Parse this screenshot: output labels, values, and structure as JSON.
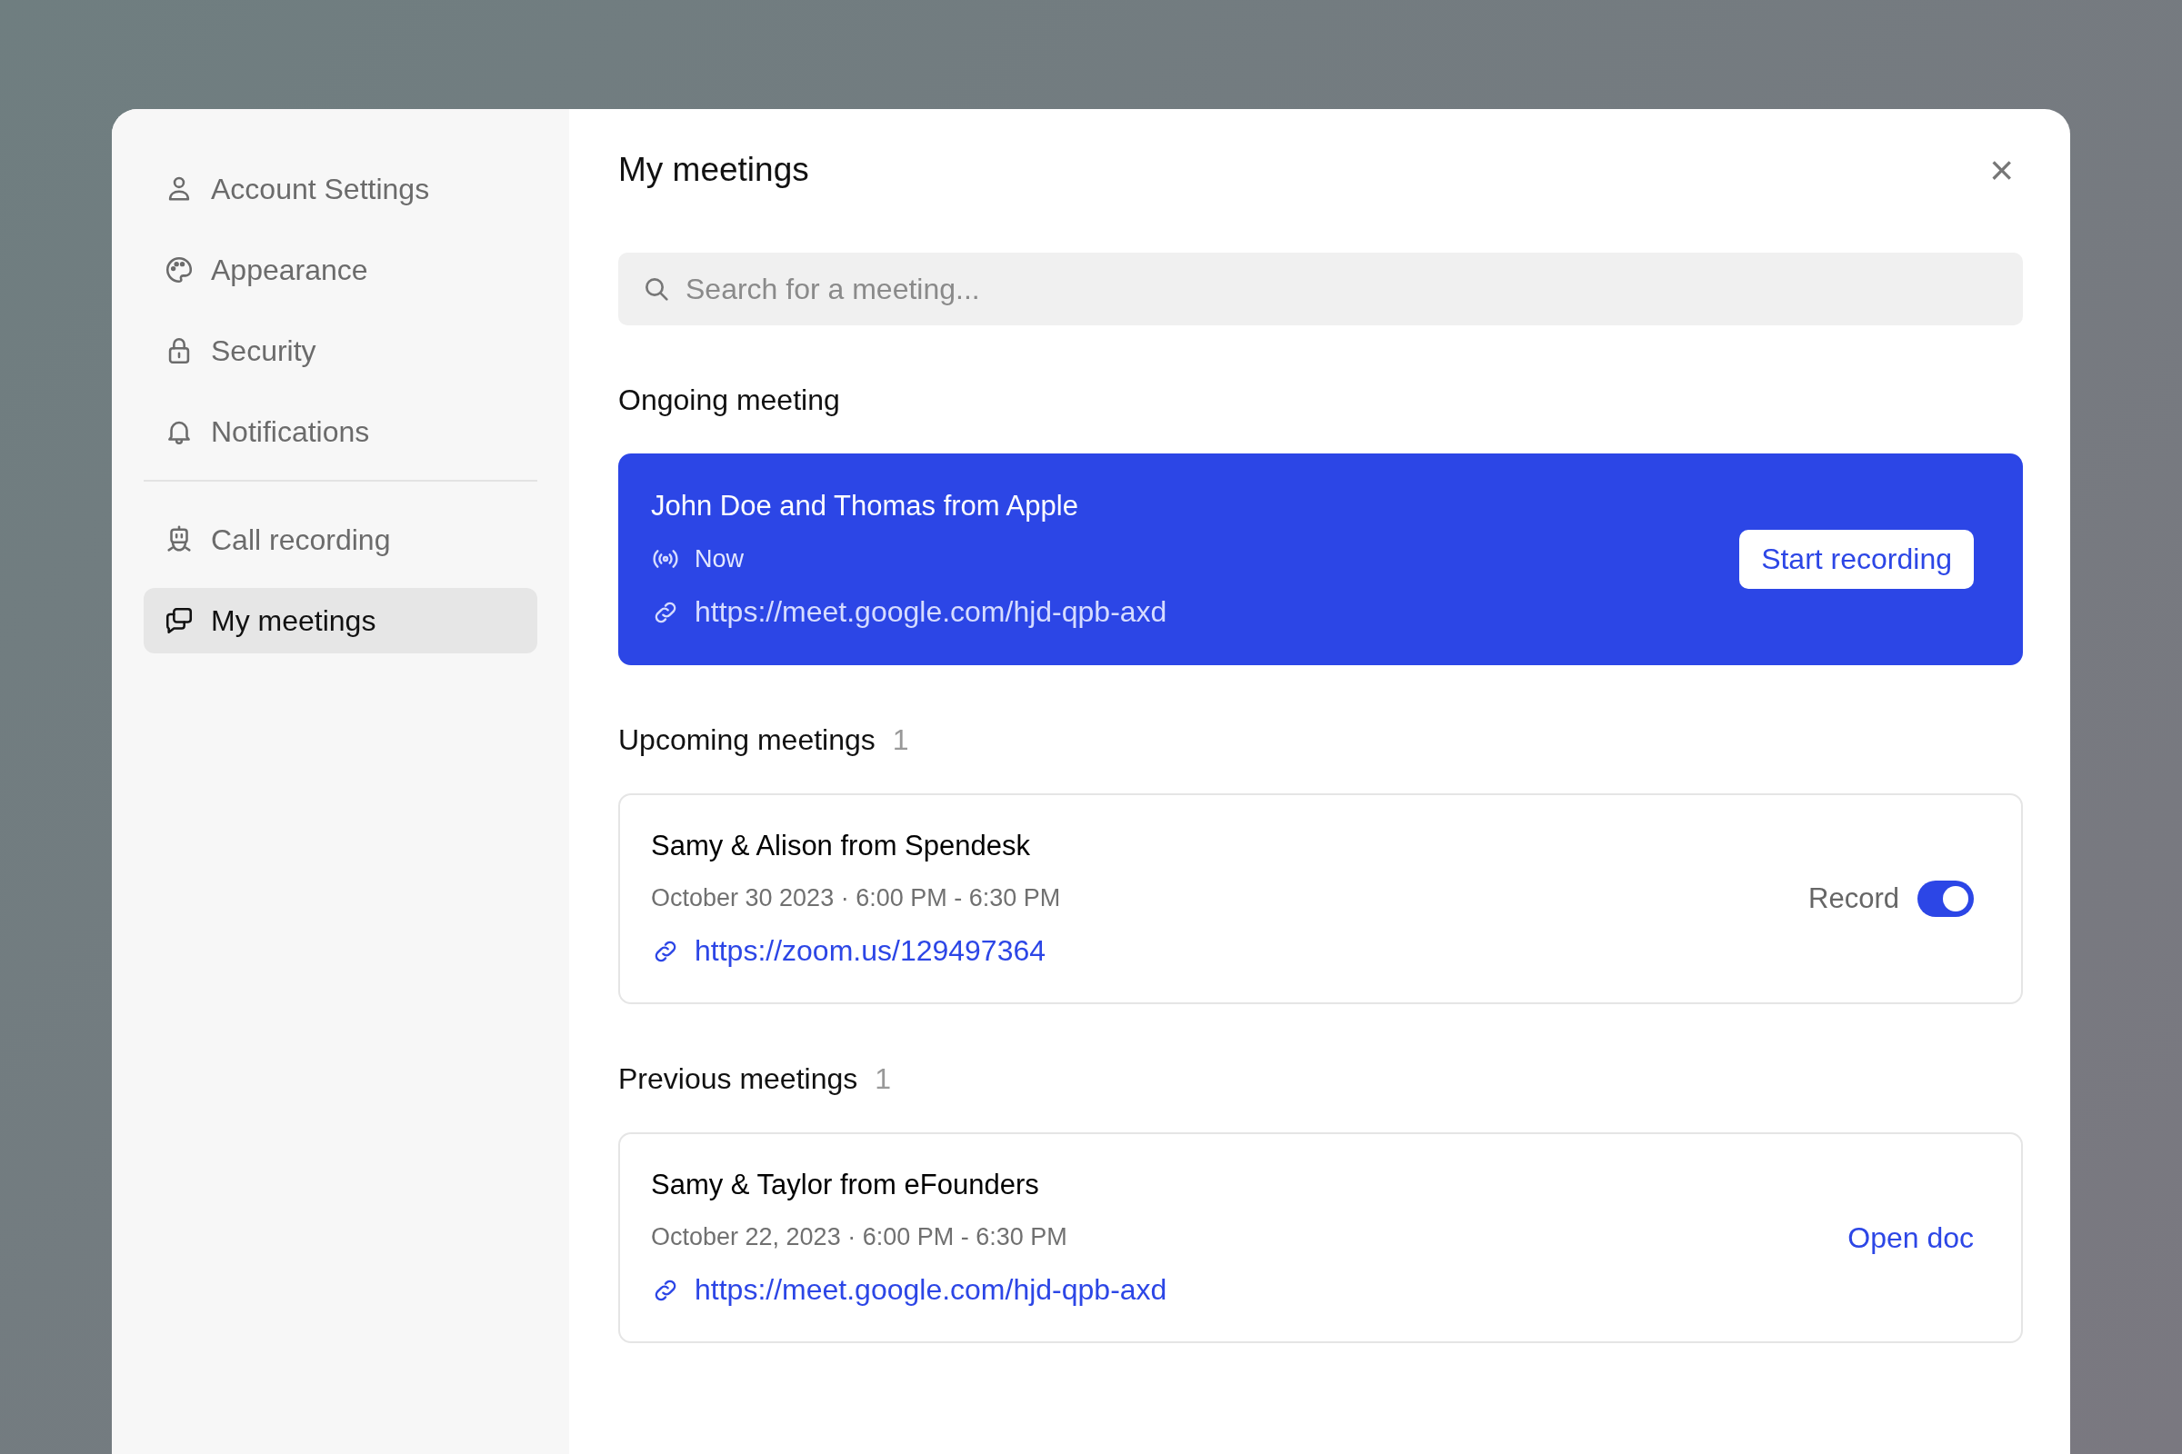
{
  "sidebar": {
    "sections": [
      {
        "items": [
          {
            "label": "Account Settings",
            "kind": "person",
            "selected": false
          },
          {
            "label": "Appearance",
            "kind": "palette",
            "selected": false
          },
          {
            "label": "Security",
            "kind": "lock",
            "selected": false
          },
          {
            "label": "Notifications",
            "kind": "bell",
            "selected": false
          }
        ]
      },
      {
        "items": [
          {
            "label": "Call recording",
            "kind": "robot",
            "selected": false
          },
          {
            "label": "My meetings",
            "kind": "chats",
            "selected": true
          }
        ]
      }
    ]
  },
  "main": {
    "title": "My meetings",
    "close": "×",
    "search": {
      "placeholder": "Search for a meeting..."
    },
    "ongoing": {
      "heading": "Ongoing meeting",
      "title": "John Doe and Thomas from Apple",
      "status": "Now",
      "link": "https://meet.google.com/hjd-qpb-axd",
      "action": "Start recording"
    },
    "upcoming": {
      "heading": "Upcoming meetings",
      "count": "1",
      "meetings": [
        {
          "title": "Samy & Alison from Spendesk",
          "time": "October 30 2023 · 6:00 PM - 6:30 PM",
          "link": "https://zoom.us/129497364",
          "kind": "toggle",
          "toggle_label": "Record",
          "on": true
        }
      ]
    },
    "previous": {
      "heading": "Previous meetings",
      "count": "1",
      "meetings": [
        {
          "title": "Samy & Taylor from eFounders",
          "time": "October 22, 2023 · 6:00 PM - 6:30 PM",
          "link": "https://meet.google.com/hjd-qpb-axd",
          "kind": "action",
          "action": "Open doc"
        }
      ]
    }
  }
}
